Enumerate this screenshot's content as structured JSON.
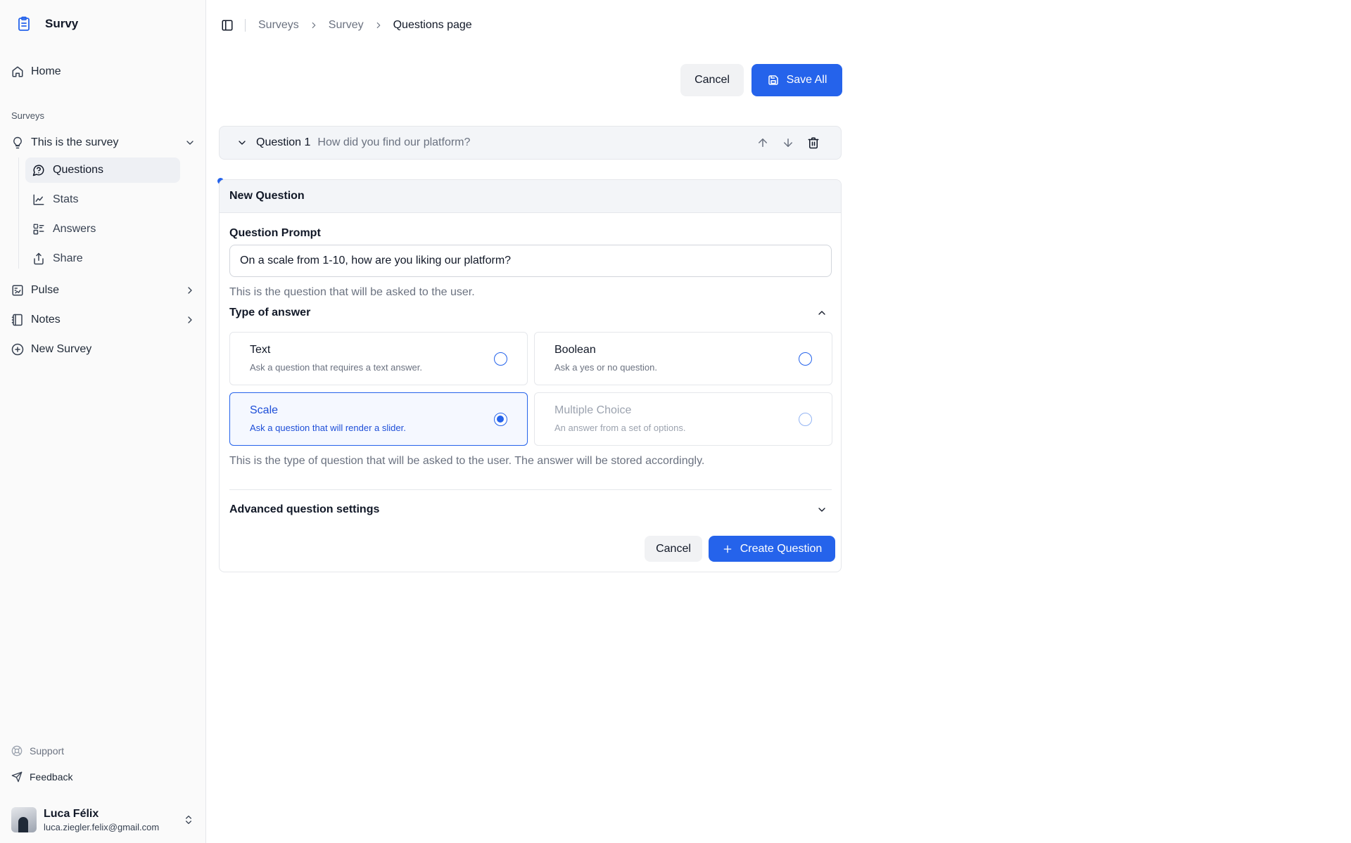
{
  "sidebar": {
    "brand": "Survy",
    "home": "Home",
    "section_label": "Surveys",
    "survey_name": "This is the survey",
    "sub_items": [
      "Questions",
      "Stats",
      "Answers",
      "Share"
    ],
    "pulse": "Pulse",
    "notes": "Notes",
    "new_survey": "New Survey",
    "support": "Support",
    "feedback": "Feedback",
    "user": {
      "name": "Luca Félix",
      "email": "luca.ziegler.felix@gmail.com"
    }
  },
  "breadcrumb": [
    "Surveys",
    "Survey",
    "Questions page"
  ],
  "header_actions": {
    "cancel": "Cancel",
    "save": "Save All"
  },
  "question1": {
    "label": "Question 1",
    "text": "How did you find our platform?"
  },
  "new_question": {
    "title": "New Question",
    "prompt_label": "Question Prompt",
    "prompt_value": "On a scale from 1-10, how are you liking our platform?",
    "prompt_hint": "This is the question that will be asked to the user.",
    "type_label": "Type of answer",
    "options": [
      {
        "title": "Text",
        "desc": "Ask a question that requires a text answer.",
        "state": "unselected"
      },
      {
        "title": "Boolean",
        "desc": "Ask a yes or no question.",
        "state": "unselected"
      },
      {
        "title": "Scale",
        "desc": "Ask a question that will render a slider.",
        "state": "selected"
      },
      {
        "title": "Multiple Choice",
        "desc": "An answer from a set of options.",
        "state": "disabled"
      }
    ],
    "type_hint": "This is the type of question that will be asked to the user. The answer will be stored accordingly.",
    "advanced_label": "Advanced question settings",
    "cancel": "Cancel",
    "create": "Create Question"
  },
  "colors": {
    "accent": "#2563eb",
    "sidebar_bg": "#fafafa",
    "panel_head_bg": "#f3f5f8"
  }
}
